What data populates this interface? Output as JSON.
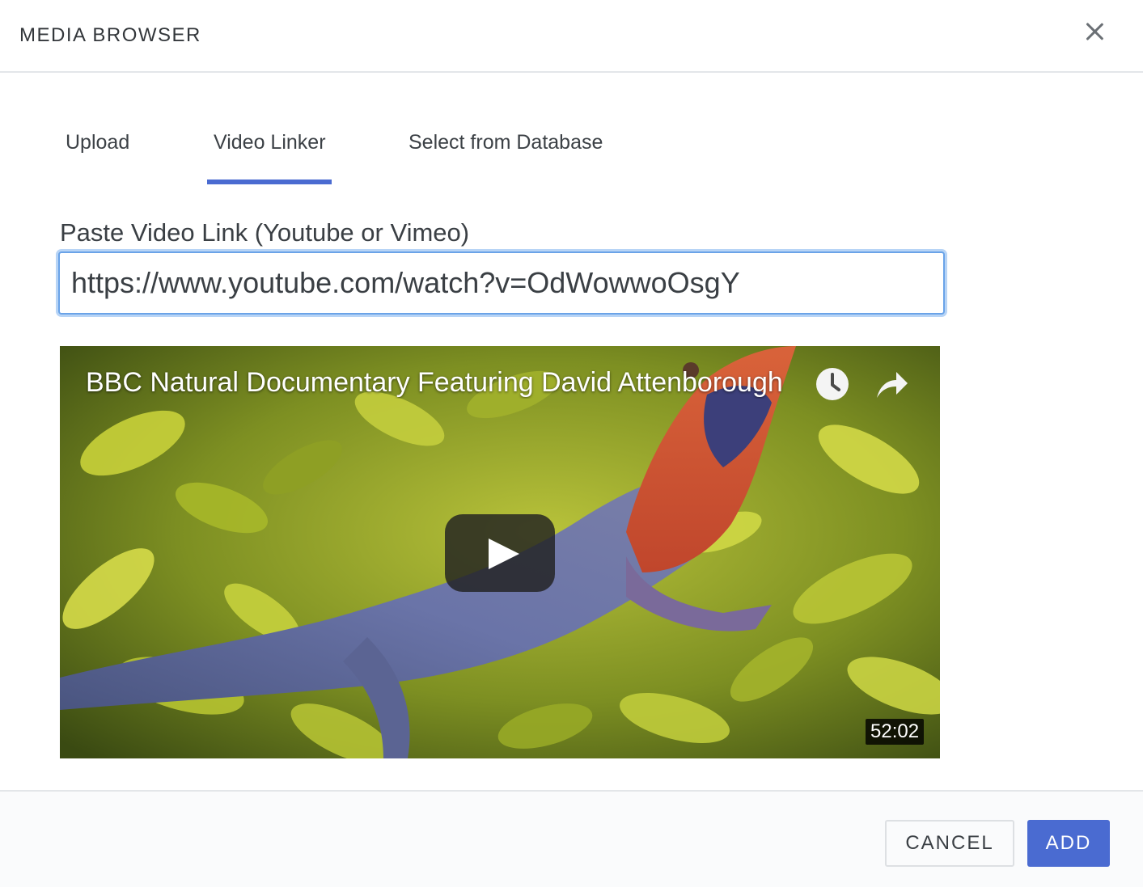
{
  "header": {
    "title": "MEDIA BROWSER",
    "close_icon": "close-icon"
  },
  "tabs": [
    {
      "label": "Upload",
      "active": false
    },
    {
      "label": "Video Linker",
      "active": true
    },
    {
      "label": "Select from Database",
      "active": false
    }
  ],
  "video_linker": {
    "field_label": "Paste Video Link (Youtube or Vimeo)",
    "url_value": "https://www.youtube.com/watch?v=OdWowwoOsgY"
  },
  "video": {
    "title": "BBC Natural Documentary Featuring David Attenborough",
    "duration": "52:02",
    "icons": [
      "clock-icon",
      "share-icon",
      "play-icon"
    ]
  },
  "footer": {
    "cancel_label": "CANCEL",
    "add_label": "ADD"
  },
  "colors": {
    "accent": "#4a6bd1",
    "input_focus": "#6aa3e8",
    "divider": "#e3e6e9"
  }
}
